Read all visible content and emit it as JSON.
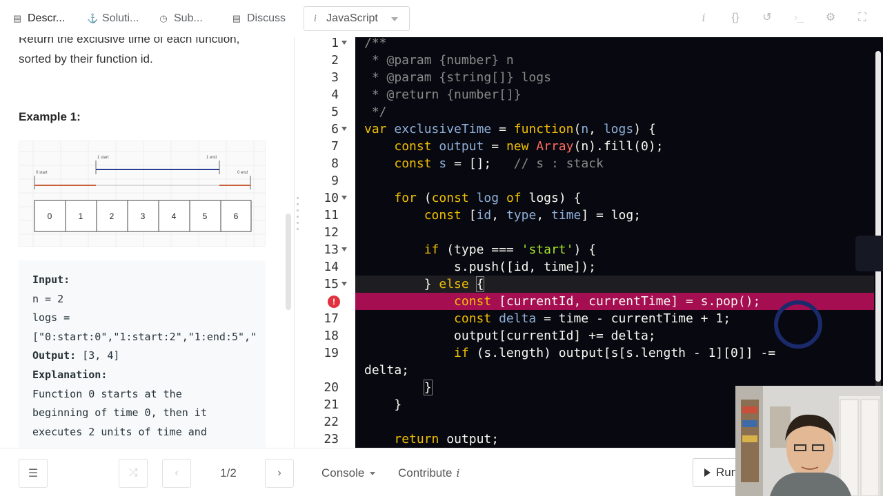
{
  "tabs": [
    {
      "label": "Descr...",
      "icon": "description-icon",
      "active": true
    },
    {
      "label": "Soluti...",
      "icon": "flask-icon",
      "active": false
    },
    {
      "label": "Sub...",
      "icon": "clock-icon",
      "active": false
    },
    {
      "label": "Discuss",
      "icon": "comment-icon",
      "active": false
    }
  ],
  "language": {
    "info": "i",
    "selected": "JavaScript"
  },
  "toolbar_icons": [
    "info-icon",
    "braces-icon",
    "reset-icon",
    "terminal-icon",
    "settings-icon",
    "fullscreen-icon"
  ],
  "description": {
    "intro_line1": "Return the exclusive time of each function,",
    "intro_line2": "sorted by their function id.",
    "example_title": "Example 1:",
    "diagram": {
      "labels": {
        "s0": "0 start",
        "s1": "1 start",
        "e1": "1 end",
        "e0": "0 end"
      },
      "cells": [
        "0",
        "1",
        "2",
        "3",
        "4",
        "5",
        "6"
      ]
    },
    "example_lines": [
      {
        "label": "Input:",
        "text": ""
      },
      {
        "label": "",
        "text": "n = 2"
      },
      {
        "label": "",
        "text": "logs ="
      },
      {
        "label": "",
        "text": "[\"0:start:0\",\"1:start:2\",\"1:end:5\",\""
      },
      {
        "label": "Output:",
        "text": " [3, 4]"
      },
      {
        "label": "Explanation:",
        "text": ""
      },
      {
        "label": "",
        "text": "Function 0 starts at the"
      },
      {
        "label": "",
        "text": "beginning of time 0, then it"
      },
      {
        "label": "",
        "text": "executes 2 units of time and"
      }
    ]
  },
  "editor": {
    "line_numbers": [
      "1",
      "2",
      "3",
      "4",
      "5",
      "6",
      "7",
      "8",
      "9",
      "10",
      "11",
      "12",
      "13",
      "14",
      "15",
      "",
      "17",
      "18",
      "19",
      "",
      "20",
      "21",
      "22",
      "23"
    ],
    "colors": {
      "error_line": "#a50f52",
      "keyword": "#f0c000",
      "string": "#a6e22e",
      "comment": "#8a8a8a"
    }
  },
  "bottombar": {
    "pager": "1/2",
    "console": "Console",
    "contribute": "Contribute",
    "contribute_info": "i",
    "run": "Run"
  }
}
